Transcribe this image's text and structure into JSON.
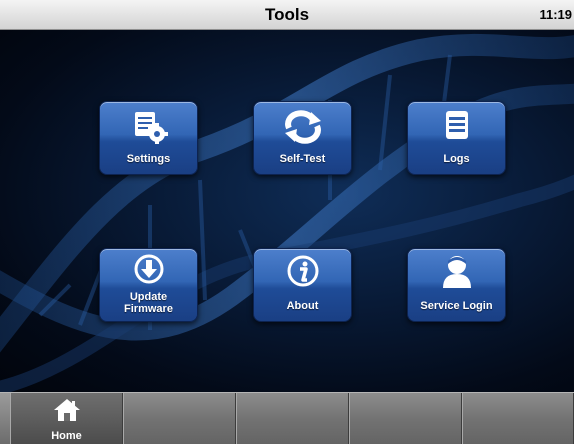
{
  "titlebar": {
    "title": "Tools",
    "clock": "11:19"
  },
  "tools": {
    "settings": {
      "label": "Settings",
      "icon": "settings-icon"
    },
    "self_test": {
      "label": "Self-Test",
      "icon": "refresh-icon"
    },
    "logs": {
      "label": "Logs",
      "icon": "list-icon"
    },
    "update_firmware": {
      "label_line1": "Update",
      "label_line2": "Firmware",
      "icon": "download-icon"
    },
    "about": {
      "label": "About",
      "icon": "info-icon"
    },
    "service_login": {
      "label": "Service Login",
      "icon": "user-icon"
    }
  },
  "navbar": {
    "home_label": "Home",
    "home_icon": "home-icon"
  },
  "colors": {
    "button_blue": "#2f5fae",
    "background": "#061330",
    "navbar_gray": "#777777"
  }
}
